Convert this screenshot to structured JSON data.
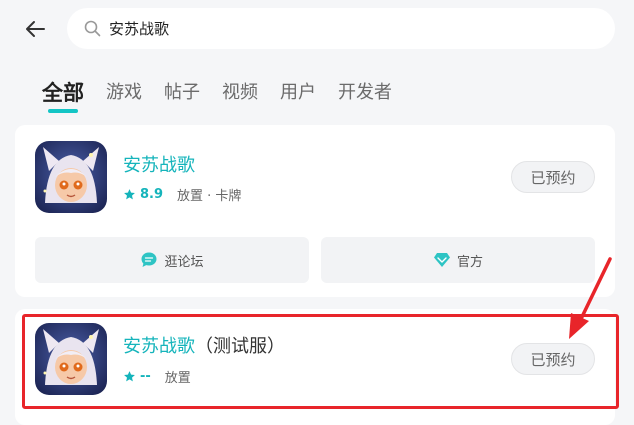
{
  "search": {
    "query": "安苏战歌"
  },
  "tabs": [
    {
      "label": "全部",
      "active": true
    },
    {
      "label": "游戏"
    },
    {
      "label": "帖子"
    },
    {
      "label": "视频"
    },
    {
      "label": "用户"
    },
    {
      "label": "开发者"
    }
  ],
  "results": [
    {
      "name": "安苏战歌",
      "suffix": "",
      "score": "8.9",
      "tags": "放置 · 卡牌",
      "button": "已预约",
      "actions": [
        {
          "label": "逛论坛",
          "icon": "chat-bubble-icon"
        },
        {
          "label": "官方",
          "icon": "diamond-icon"
        }
      ]
    },
    {
      "name": "安苏战歌",
      "suffix": "（测试服）",
      "score": "--",
      "tags": "放置",
      "button": "已预约"
    }
  ],
  "colors": {
    "accent": "#15b4bb",
    "annotation": "#e8252a"
  }
}
